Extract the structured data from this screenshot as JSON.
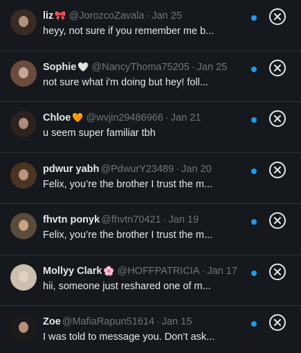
{
  "messages": [
    {
      "name": "liz",
      "emoji": "🎀",
      "emoji_color": "#e0245e",
      "handle": "@JorozcoZavala",
      "date": "Jan 25",
      "preview": "heyy, not sure if you remember me b...",
      "avatar_colors": [
        "#3a2a24",
        "#c9a38f"
      ]
    },
    {
      "name": "Sophie",
      "emoji": "🤍",
      "emoji_color": "#ffffff",
      "handle": "@NancyThoma75205",
      "date": "Jan 25",
      "preview": "not sure what i'm doing but hey! foll...",
      "avatar_colors": [
        "#6b4b3e",
        "#d8b7a3"
      ]
    },
    {
      "name": "Chloe",
      "emoji": "🧡",
      "emoji_color": "#f4900c",
      "handle": "@wvjin29486966",
      "date": "Jan 21",
      "preview": "u seem super familiar tbh",
      "avatar_colors": [
        "#2b2220",
        "#c79e8a"
      ]
    },
    {
      "name": "pdwur yabh",
      "emoji": "",
      "emoji_color": "",
      "handle": "@PdwurY23489",
      "date": "Jan 20",
      "preview": "Felix, you’re the brother I trust the m...",
      "avatar_colors": [
        "#4a3424",
        "#cfa58c"
      ]
    },
    {
      "name": "fhvtn ponyk",
      "emoji": "",
      "emoji_color": "",
      "handle": "@fhvtn70421",
      "date": "Jan 19",
      "preview": "Felix, you’re the brother I trust the m...",
      "avatar_colors": [
        "#5c4a3a",
        "#d7b48f"
      ]
    },
    {
      "name": "Mollyy Clark",
      "emoji": "🌸",
      "emoji_color": "#f4abba",
      "handle": "@HOFFPATRICIA",
      "date": "Jan 17",
      "preview": "hii, someone just reshared one of m...",
      "avatar_colors": [
        "#cdbfb0",
        "#e6d2c2"
      ]
    },
    {
      "name": "Zoe",
      "emoji": "",
      "emoji_color": "",
      "handle": "@MafiaRapun51614",
      "date": "Jan 15",
      "preview": "I was told to message you. Don’t ask...",
      "avatar_colors": [
        "#1c1a1a",
        "#cfa790"
      ]
    }
  ],
  "colors": {
    "background": "#15181c",
    "divider": "#2f3336",
    "unread_dot": "#1d9bf0",
    "primary_text": "#e7e9ea",
    "secondary_text": "#71767b"
  },
  "separator": "·"
}
